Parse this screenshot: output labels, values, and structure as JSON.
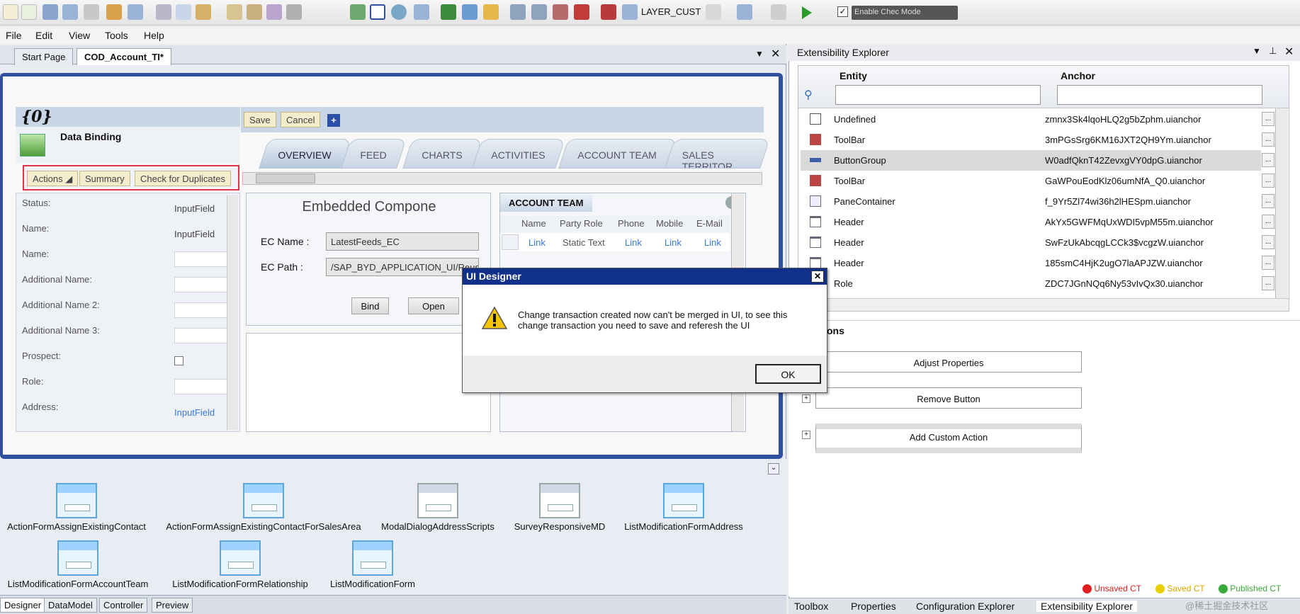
{
  "toolbar": {
    "layer_label": "LAYER_CUST",
    "check_label": "Enable Chec Mode"
  },
  "menu": [
    "File",
    "Edit",
    "View",
    "Tools",
    "Help"
  ],
  "doc_tabs": [
    "Start Page",
    "COD_Account_TI*"
  ],
  "designer": {
    "placeholder_title": "{0}",
    "data_binding_label": "Data Binding",
    "buttons": {
      "save": "Save",
      "cancel": "Cancel"
    },
    "actions": [
      "Actions",
      "Summary",
      "Check for Duplicates"
    ],
    "tabs": [
      "OVERVIEW",
      "FEED",
      "CHARTS",
      "ACTIVITIES",
      "ACCOUNT TEAM",
      "SALES TERRITOR"
    ],
    "fields": [
      {
        "label": "Status:",
        "value": "InputField"
      },
      {
        "label": "Name:",
        "value": "InputField"
      },
      {
        "label": "Name:",
        "value": ""
      },
      {
        "label": "Additional Name:",
        "value": ""
      },
      {
        "label": "Additional Name 2:",
        "value": ""
      },
      {
        "label": "Additional Name 3:",
        "value": ""
      },
      {
        "label": "Prospect:",
        "value": ""
      },
      {
        "label": "Role:",
        "value": ""
      },
      {
        "label": "Address:",
        "value": "InputField"
      }
    ],
    "embedded": {
      "title": "Embedded Compone",
      "ec_name_label": "EC Name :",
      "ec_name_value": "LatestFeeds_EC",
      "ec_path_label": "EC Path :",
      "ec_path_value": "/SAP_BYD_APPLICATION_UI/Reus",
      "bind": "Bind",
      "open": "Open"
    },
    "account_team": {
      "title": "ACCOUNT TEAM",
      "columns": [
        "Name",
        "Party Role",
        "Phone",
        "Mobile",
        "E-Mail"
      ],
      "row": [
        "Link",
        "Static Text",
        "Link",
        "Link",
        "Link"
      ]
    }
  },
  "components": [
    "ActionFormAssignExistingContact",
    "ActionFormAssignExistingContactForSalesArea",
    "ModalDialogAddressScripts",
    "SurveyResponsiveMD",
    "ListModificationFormAddress",
    "ListModificationFormAccountTeam",
    "ListModificationFormRelationship",
    "ListModificationForm"
  ],
  "bottom_tabs": [
    "Designer",
    "DataModel",
    "Controller",
    "Preview"
  ],
  "explorer": {
    "title": "Extensibility Explorer",
    "col_entity": "Entity",
    "col_anchor": "Anchor",
    "rows": [
      {
        "entity": "Undefined",
        "anchor": "zmnx3Sk4lqoHLQ2g5bZphm.uianchor"
      },
      {
        "entity": "ToolBar",
        "anchor": "3mPGsSrg6KM16JXT2QH9Ym.uianchor"
      },
      {
        "entity": "ButtonGroup",
        "anchor": "W0adfQknT42ZevxgVY0dpG.uianchor"
      },
      {
        "entity": "ToolBar",
        "anchor": "GaWPouEodKlz06umNfA_Q0.uianchor"
      },
      {
        "entity": "PaneContainer",
        "anchor": "f_9Yr5Zl74wi36h2lHESpm.uianchor"
      },
      {
        "entity": "Header",
        "anchor": "AkYx5GWFMqUxWDI5vpM55m.uianchor"
      },
      {
        "entity": "Header",
        "anchor": "SwFzUkAbcqgLCCk3$vcgzW.uianchor"
      },
      {
        "entity": "Header",
        "anchor": "185smC4HjK2ugO7laAPJZW.uianchor"
      },
      {
        "entity": "Role",
        "anchor": "ZDC7JGnNQq6Ny53vIvQx30.uianchor"
      }
    ],
    "actions_header": "ons",
    "action_buttons": [
      "Adjust Properties",
      "Remove Button",
      "Add Custom Action"
    ],
    "legend": {
      "unsaved": "Unsaved CT",
      "saved": "Saved CT",
      "published": "Published CT"
    },
    "tabs": [
      "Toolbox",
      "Properties",
      "Configuration Explorer",
      "Extensibility Explorer"
    ],
    "watermark": "@稀土掘金技术社区"
  },
  "dialog": {
    "title": "UI Designer",
    "message_line1": "Change transaction created now can't be merged in UI, to see this",
    "message_line2": "change transaction you need to save and referesh the UI",
    "ok": "OK"
  },
  "colors": {
    "accent": "#2f4f9f",
    "dialog_title": "#10308a",
    "link": "#3a7bd5",
    "unsaved": "#e02020",
    "saved": "#d8b800",
    "published": "#3aa83a"
  }
}
